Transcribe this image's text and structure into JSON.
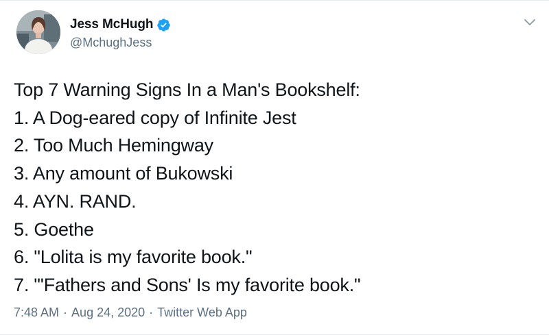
{
  "author": {
    "display_name": "Jess McHugh",
    "handle": "@MchughJess",
    "verified": true,
    "avatar_icon": "profile-photo"
  },
  "tweet": {
    "lines": [
      "Top 7 Warning Signs In a Man's Bookshelf:",
      "1. A Dog-eared copy of Infinite Jest",
      "2. Too Much Hemingway",
      "3. Any amount of Bukowski",
      "4. AYN. RAND.",
      "5. Goethe",
      "6. \"Lolita is my favorite book.\"",
      "7. \"'Fathers and Sons' Is my favorite book.\""
    ]
  },
  "meta": {
    "time": "7:48 AM",
    "separator": "·",
    "date": "Aug 24, 2020",
    "source": "Twitter Web App"
  },
  "colors": {
    "verified_badge": "#1da1f2",
    "secondary_text": "#5b7083",
    "primary_text": "#0f1419"
  },
  "icons": {
    "verified": "verified-badge-icon",
    "more": "chevron-down-icon"
  }
}
